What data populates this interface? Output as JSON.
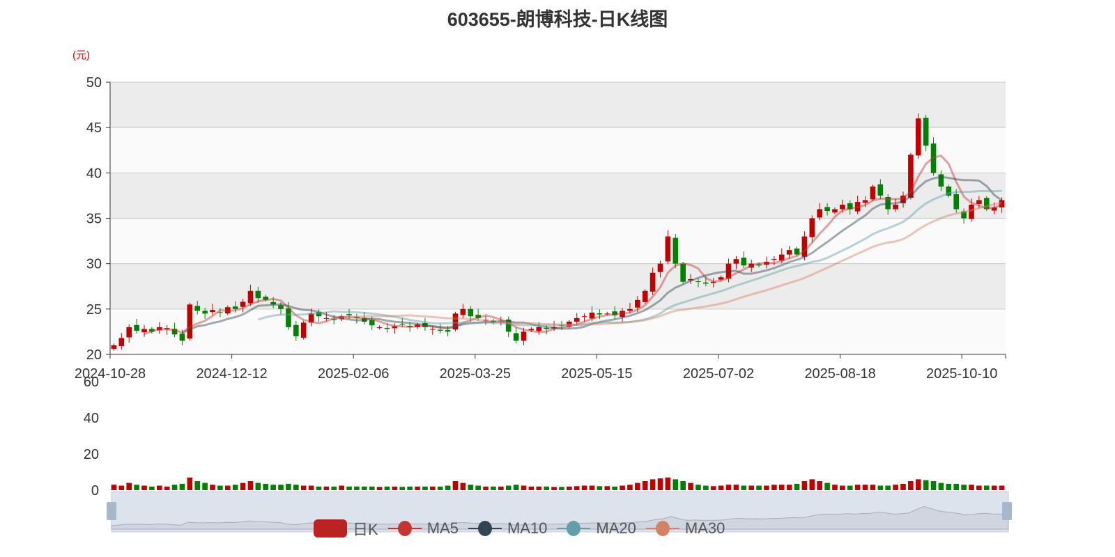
{
  "title": "603655-朗博科技-日K线图",
  "unit": "(元)",
  "legend": [
    {
      "label": "日K",
      "color": "#c00000"
    },
    {
      "label": "MA5",
      "color": "#c23531"
    },
    {
      "label": "MA10",
      "color": "#2f4554"
    },
    {
      "label": "MA20",
      "color": "#61a0a8"
    },
    {
      "label": "MA30",
      "color": "#d48265"
    }
  ],
  "chart_data": {
    "type": "candlestick",
    "title": "603655-朗博科技-日K线图",
    "ylabel": "(元)",
    "ylim": [
      20,
      50
    ],
    "yticks": [
      20,
      25,
      30,
      35,
      40,
      45,
      50
    ],
    "vol_ylim": [
      0,
      60
    ],
    "vol_yticks": [
      0,
      20,
      40,
      60
    ],
    "xticks": [
      "2024-10-28",
      "2024-12-12",
      "2025-02-06",
      "2025-03-25",
      "2025-05-15",
      "2025-07-02",
      "2025-08-18",
      "2025-10-10"
    ],
    "close": [
      21,
      21.8,
      23,
      22.6,
      22.8,
      22.5,
      23,
      22.9,
      22.2,
      21.5,
      25.5,
      24.8,
      24.5,
      24.9,
      24.6,
      25.2,
      25,
      25.8,
      27,
      26.2,
      26,
      25.5,
      25,
      23,
      22,
      23.5,
      24.5,
      24.2,
      24,
      23.8,
      24.2,
      24.3,
      24,
      23.6,
      23.2,
      23,
      22.8,
      23.1,
      23.3,
      23,
      23.3,
      23,
      22.8,
      22.6,
      22.5,
      24.5,
      25,
      24.2,
      24,
      23.8,
      23.5,
      23.6,
      22.5,
      21.5,
      22.5,
      22.8,
      23,
      22.8,
      23,
      23.2,
      23.6,
      24,
      24.2,
      24.6,
      24.4,
      24.5,
      24.3,
      24.8,
      25,
      26,
      27,
      29,
      30,
      33,
      30,
      28,
      28.3,
      28,
      27.8,
      28,
      28.5,
      30,
      30.5,
      29.8,
      30,
      29.8,
      30.2,
      30.5,
      31,
      31.5,
      31,
      33,
      35,
      36,
      35.8,
      36,
      36.5,
      36,
      36.8,
      37,
      38.5,
      37.5,
      36,
      36.5,
      37.5,
      42,
      46,
      43,
      40,
      38.5,
      37.5,
      36,
      35,
      36.5,
      37,
      36,
      36.2,
      37
    ],
    "volume": [
      3,
      2.5,
      4,
      3,
      2.5,
      2,
      2.5,
      2,
      3,
      3.5,
      7,
      5,
      4,
      3,
      2.5,
      2.5,
      3,
      4,
      5,
      4,
      3.5,
      3,
      3,
      3.5,
      3,
      2.5,
      2.5,
      2,
      2,
      2,
      2.5,
      2,
      2,
      2,
      2,
      1.8,
      2,
      2,
      1.8,
      2,
      2,
      2,
      2,
      2,
      2.5,
      5,
      4,
      3,
      2.5,
      2,
      2,
      2,
      2.5,
      3,
      2.5,
      2,
      2,
      2,
      1.8,
      1.8,
      2,
      2.2,
      2.5,
      2.5,
      2.2,
      2.2,
      2,
      2.5,
      3,
      4,
      5,
      6,
      6.5,
      7,
      6,
      5,
      4,
      3,
      2.5,
      2.2,
      2.5,
      3,
      3,
      2.5,
      2.5,
      2.5,
      2.5,
      3,
      3,
      3,
      3.5,
      5,
      6,
      5,
      4,
      3,
      2.5,
      2.5,
      3,
      3,
      3,
      2.5,
      2.5,
      3,
      3.5,
      5,
      6,
      5.5,
      5,
      4,
      3.5,
      3.5,
      3,
      3,
      2.5,
      2.5,
      2.5,
      2.5
    ]
  }
}
